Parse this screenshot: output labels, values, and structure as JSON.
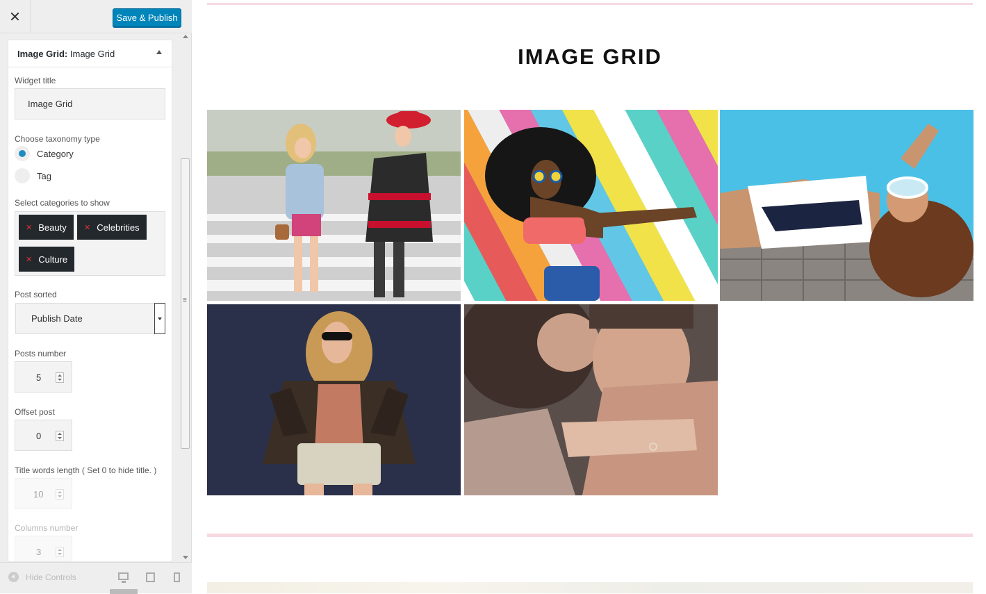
{
  "sidebar": {
    "close_icon": "close-icon",
    "publish_label": "Save & Publish",
    "widget_header": {
      "type": "Image Grid:",
      "name": "Image Grid"
    },
    "widget_title": {
      "label": "Widget title",
      "value": "Image Grid"
    },
    "taxonomy": {
      "label": "Choose taxonomy type",
      "options": [
        {
          "label": "Category",
          "checked": true
        },
        {
          "label": "Tag",
          "checked": false
        }
      ]
    },
    "categories": {
      "label": "Select categories to show",
      "chips": [
        "Beauty",
        "Celebrities",
        "Culture"
      ]
    },
    "post_sorted": {
      "label": "Post sorted",
      "value": "Publish Date"
    },
    "posts_number": {
      "label": "Posts number",
      "value": "5"
    },
    "offset_post": {
      "label": "Offset post",
      "value": "0"
    },
    "title_words": {
      "label": "Title words length ( Set 0 to hide title. )",
      "value": "10"
    },
    "columns_number": {
      "label": "Columns number",
      "value": "3"
    },
    "footer": {
      "hide_controls": "Hide Controls",
      "devices": [
        "desktop-icon",
        "tablet-icon",
        "mobile-icon"
      ]
    }
  },
  "preview": {
    "section_title": "IMAGE GRID",
    "accent_color": "#f7d9e1",
    "images": [
      {
        "name": "image-two-women-walking"
      },
      {
        "name": "image-woman-colorful-planks"
      },
      {
        "name": "image-woman-swimsuit-pool"
      },
      {
        "name": "image-woman-leather-jacket"
      },
      {
        "name": "image-couple-embrace"
      }
    ]
  }
}
